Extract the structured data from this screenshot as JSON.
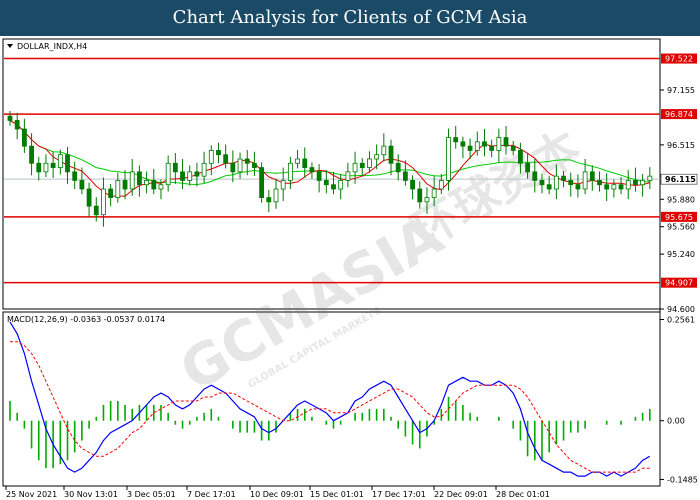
{
  "header": {
    "title": "Chart Analysis for Clients of GCM Asia"
  },
  "watermark": {
    "brand": "GCMASIA",
    "chinese": "环球资本",
    "tagline": "GLOBAL CAPITAL MARKETS"
  },
  "colors": {
    "level_line": "#e00000",
    "current_line": "#b8c4cc",
    "bull_candle": "#007a00",
    "bear_candle": "#007a00",
    "ma_red": "#e00000",
    "ma_green": "#00cc00",
    "macd_line": "#0000ff",
    "signal_line": "#ff0000",
    "histogram": "#00aa00",
    "current_badge_bg": "#ffffff",
    "level_badge_bg": "#e00000"
  },
  "chart_data": [
    {
      "type": "candlestick",
      "symbol_label": "DOLLAR_INDX,H4",
      "ylim": [
        94.6,
        97.75
      ],
      "y_ticks": [
        "97.155",
        "96.515",
        "95.880",
        "95.560",
        "95.240",
        "94.600"
      ],
      "x_labels": [
        "25 Nov 2021",
        "30 Nov 13:01",
        "3 Dec 05:01",
        "7 Dec 17:01",
        "10 Dec 09:01",
        "15 Dec 01:01",
        "17 Dec 17:01",
        "22 Dec 09:01",
        "28 Dec 01:01"
      ],
      "levels": [
        "97.522",
        "96.874",
        "95.675",
        "94.907"
      ],
      "current_price": "96.115",
      "close": [
        96.8,
        96.7,
        96.5,
        96.3,
        96.2,
        96.3,
        96.25,
        96.4,
        96.2,
        96.1,
        96.0,
        95.8,
        95.7,
        96.0,
        95.9,
        96.1,
        96.0,
        96.2,
        96.05,
        96.1,
        96.0,
        96.05,
        96.3,
        96.2,
        96.1,
        96.2,
        96.15,
        96.3,
        96.45,
        96.4,
        96.3,
        96.2,
        96.35,
        96.3,
        96.25,
        95.9,
        95.85,
        96.0,
        96.1,
        96.3,
        96.35,
        96.25,
        96.2,
        96.1,
        96.05,
        96.0,
        96.1,
        96.2,
        96.3,
        96.25,
        96.35,
        96.4,
        96.5,
        96.3,
        96.2,
        96.1,
        96.0,
        95.85,
        95.9,
        96.0,
        96.1,
        96.6,
        96.55,
        96.5,
        96.45,
        96.55,
        96.5,
        96.45,
        96.6,
        96.5,
        96.45,
        96.3,
        96.2,
        96.1,
        96.05,
        96.0,
        96.15,
        96.1,
        96.05,
        96.0,
        96.2,
        96.1,
        96.05,
        96.0,
        96.05,
        96.0,
        96.1,
        96.05,
        96.1,
        96.15
      ],
      "macd_label": "MACD(12,26,9) -0.0363 -0.0537 0.0174",
      "macd_ylim": [
        -0.16,
        0.27
      ],
      "macd_ticks": [
        "0.2561",
        "0.00",
        "-0.1485"
      ],
      "macd": [
        0.25,
        0.22,
        0.17,
        0.1,
        0.04,
        -0.02,
        -0.06,
        -0.09,
        -0.12,
        -0.13,
        -0.12,
        -0.1,
        -0.08,
        -0.05,
        -0.03,
        -0.02,
        -0.01,
        0.0,
        0.02,
        0.04,
        0.06,
        0.07,
        0.06,
        0.04,
        0.03,
        0.04,
        0.06,
        0.08,
        0.09,
        0.08,
        0.07,
        0.05,
        0.03,
        0.02,
        0.01,
        -0.02,
        -0.03,
        -0.02,
        0.0,
        0.02,
        0.04,
        0.05,
        0.04,
        0.03,
        0.02,
        0.0,
        0.01,
        0.02,
        0.05,
        0.06,
        0.08,
        0.09,
        0.1,
        0.09,
        0.06,
        0.03,
        0.0,
        -0.03,
        -0.02,
        0.0,
        0.04,
        0.09,
        0.1,
        0.11,
        0.1,
        0.1,
        0.09,
        0.09,
        0.1,
        0.09,
        0.07,
        0.03,
        -0.03,
        -0.07,
        -0.1,
        -0.11,
        -0.12,
        -0.13,
        -0.13,
        -0.14,
        -0.14,
        -0.13,
        -0.13,
        -0.14,
        -0.13,
        -0.14,
        -0.13,
        -0.12,
        -0.1,
        -0.09
      ],
      "signal": [
        0.2,
        0.2,
        0.19,
        0.17,
        0.14,
        0.1,
        0.06,
        0.02,
        -0.02,
        -0.05,
        -0.07,
        -0.08,
        -0.09,
        -0.09,
        -0.08,
        -0.07,
        -0.05,
        -0.03,
        -0.02,
        0.0,
        0.02,
        0.03,
        0.04,
        0.05,
        0.05,
        0.05,
        0.05,
        0.06,
        0.06,
        0.07,
        0.07,
        0.07,
        0.06,
        0.05,
        0.04,
        0.03,
        0.02,
        0.01,
        0.0,
        0.0,
        0.01,
        0.02,
        0.03,
        0.03,
        0.03,
        0.02,
        0.02,
        0.02,
        0.03,
        0.04,
        0.05,
        0.06,
        0.07,
        0.08,
        0.08,
        0.07,
        0.06,
        0.04,
        0.02,
        0.01,
        0.01,
        0.03,
        0.05,
        0.07,
        0.08,
        0.09,
        0.09,
        0.09,
        0.09,
        0.09,
        0.09,
        0.08,
        0.06,
        0.03,
        0.0,
        -0.03,
        -0.06,
        -0.08,
        -0.1,
        -0.11,
        -0.12,
        -0.13,
        -0.13,
        -0.13,
        -0.13,
        -0.13,
        -0.13,
        -0.13,
        -0.12,
        -0.12
      ]
    }
  ]
}
